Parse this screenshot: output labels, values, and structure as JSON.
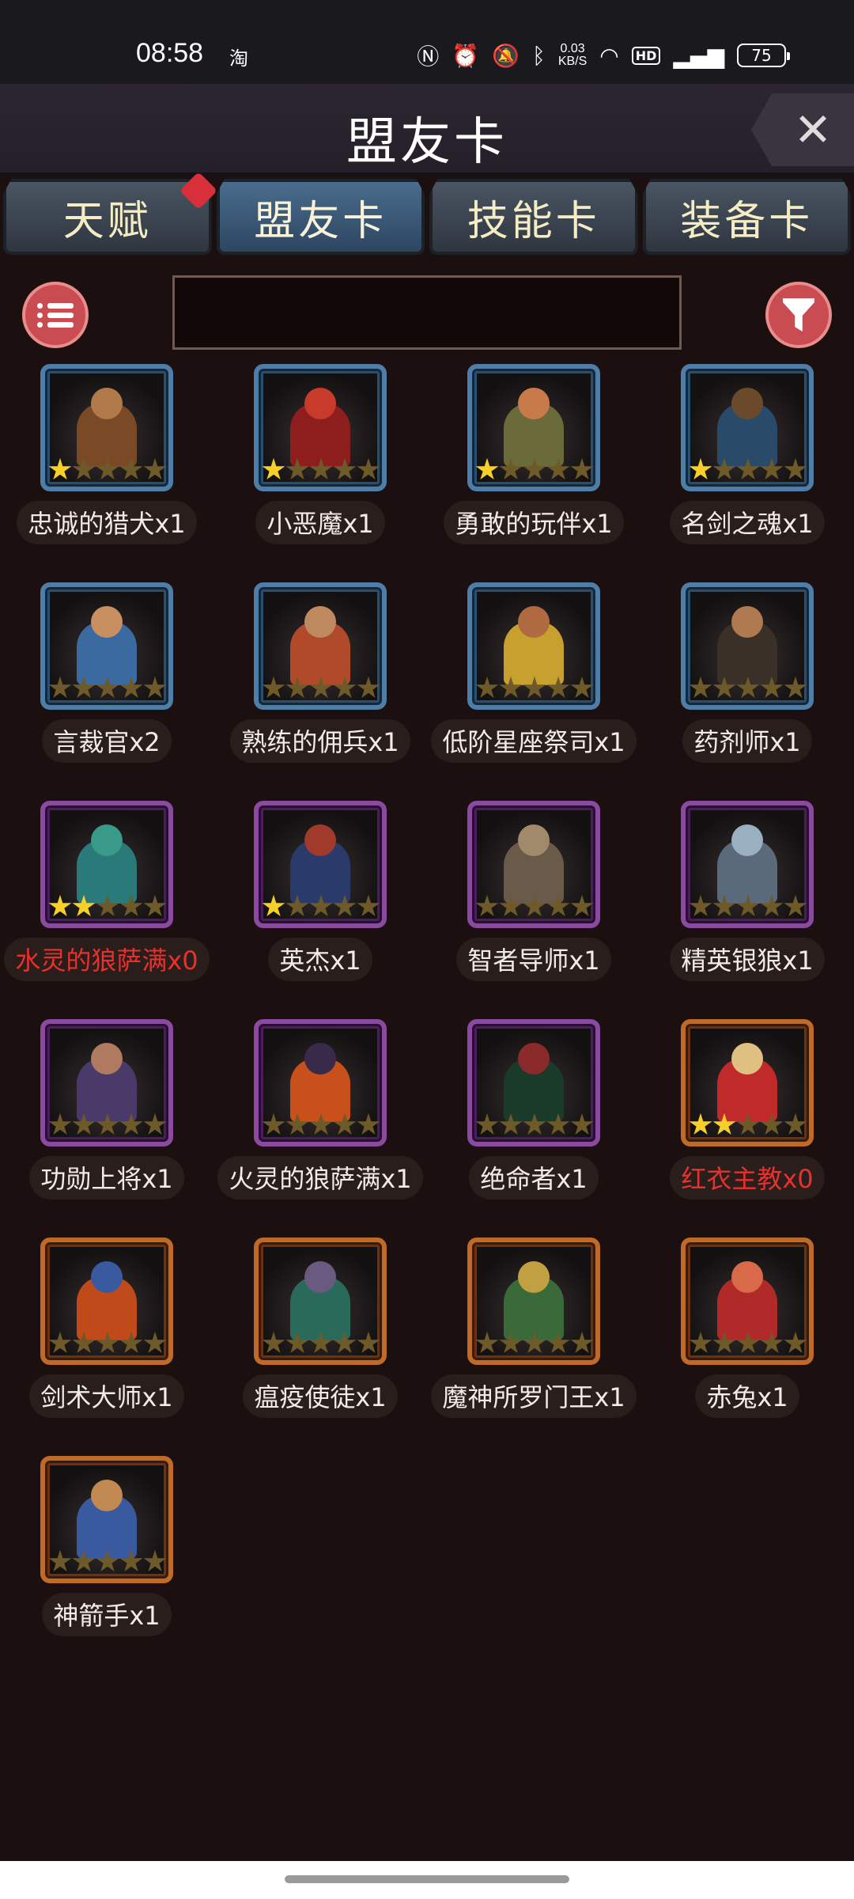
{
  "status_bar": {
    "time": "08:58",
    "carrier_icon": "淘",
    "network_speed_top": "0.03",
    "network_speed_bottom": "KB/S",
    "battery": "75"
  },
  "header": {
    "title": "盟友卡",
    "close_icon": "close-icon"
  },
  "tabs": [
    {
      "label": "天赋",
      "active": false,
      "badge": true
    },
    {
      "label": "盟友卡",
      "active": true,
      "badge": false
    },
    {
      "label": "技能卡",
      "active": false,
      "badge": false
    },
    {
      "label": "装备卡",
      "active": false,
      "badge": false
    }
  ],
  "search": {
    "value": "",
    "placeholder": ""
  },
  "cards": [
    {
      "name": "忠诚的猎犬x1",
      "rarity": "blue",
      "stars": 1,
      "red": false,
      "palette": [
        "#7a4a26",
        "#b07a4a"
      ]
    },
    {
      "name": "小恶魔x1",
      "rarity": "blue",
      "stars": 1,
      "red": false,
      "palette": [
        "#8e1e1e",
        "#c83a2a"
      ]
    },
    {
      "name": "勇敢的玩伴x1",
      "rarity": "blue",
      "stars": 1,
      "red": false,
      "palette": [
        "#6a6a3a",
        "#c87a4a"
      ]
    },
    {
      "name": "名剑之魂x1",
      "rarity": "blue",
      "stars": 1,
      "red": false,
      "palette": [
        "#2a4a6a",
        "#6a4a2a"
      ]
    },
    {
      "name": "言裁官x2",
      "rarity": "blue",
      "stars": 0,
      "red": false,
      "palette": [
        "#3a6aa0",
        "#c89060"
      ]
    },
    {
      "name": "熟练的佣兵x1",
      "rarity": "blue",
      "stars": 0,
      "red": false,
      "palette": [
        "#b04a2a",
        "#c08a60"
      ]
    },
    {
      "name": "低阶星座祭司x1",
      "rarity": "blue",
      "stars": 0,
      "red": false,
      "palette": [
        "#c8a030",
        "#b06a40"
      ]
    },
    {
      "name": "药剂师x1",
      "rarity": "blue",
      "stars": 0,
      "red": false,
      "palette": [
        "#3a3028",
        "#b07a50"
      ]
    },
    {
      "name": "水灵的狼萨满x0",
      "rarity": "purple",
      "stars": 2,
      "red": true,
      "palette": [
        "#2a7a7a",
        "#3a9a8a"
      ]
    },
    {
      "name": "英杰x1",
      "rarity": "purple",
      "stars": 1,
      "red": false,
      "palette": [
        "#2a3a6a",
        "#a03a2a"
      ]
    },
    {
      "name": "智者导师x1",
      "rarity": "purple",
      "stars": 0,
      "red": false,
      "palette": [
        "#6a5a4a",
        "#a08a6a"
      ]
    },
    {
      "name": "精英银狼x1",
      "rarity": "purple",
      "stars": 0,
      "red": false,
      "palette": [
        "#5a6a7a",
        "#9ab0c0"
      ]
    },
    {
      "name": "功勋上将x1",
      "rarity": "purple",
      "stars": 0,
      "red": false,
      "palette": [
        "#4a3a6a",
        "#b07a60"
      ]
    },
    {
      "name": "火灵的狼萨满x1",
      "rarity": "purple",
      "stars": 0,
      "red": false,
      "palette": [
        "#c8501a",
        "#3a2a4a"
      ]
    },
    {
      "name": "绝命者x1",
      "rarity": "purple",
      "stars": 0,
      "red": false,
      "palette": [
        "#1a3a2a",
        "#8a2a2a"
      ]
    },
    {
      "name": "红衣主教x0",
      "rarity": "orange",
      "stars": 2,
      "red": true,
      "palette": [
        "#c02a2a",
        "#e0c080"
      ]
    },
    {
      "name": "剑术大师x1",
      "rarity": "orange",
      "stars": 0,
      "red": false,
      "palette": [
        "#c04a1a",
        "#3a5aa0"
      ]
    },
    {
      "name": "瘟疫使徒x1",
      "rarity": "orange",
      "stars": 0,
      "red": false,
      "palette": [
        "#2a6a5a",
        "#6a5a80"
      ]
    },
    {
      "name": "魔神所罗门王x1",
      "rarity": "orange",
      "stars": 0,
      "red": false,
      "palette": [
        "#3a6a3a",
        "#c0a040"
      ]
    },
    {
      "name": "赤兔x1",
      "rarity": "orange",
      "stars": 0,
      "red": false,
      "palette": [
        "#b02a2a",
        "#d86a4a"
      ]
    },
    {
      "name": "神箭手x1",
      "rarity": "orange",
      "stars": 0,
      "red": false,
      "palette": [
        "#3a5aa0",
        "#c08a50"
      ]
    }
  ]
}
